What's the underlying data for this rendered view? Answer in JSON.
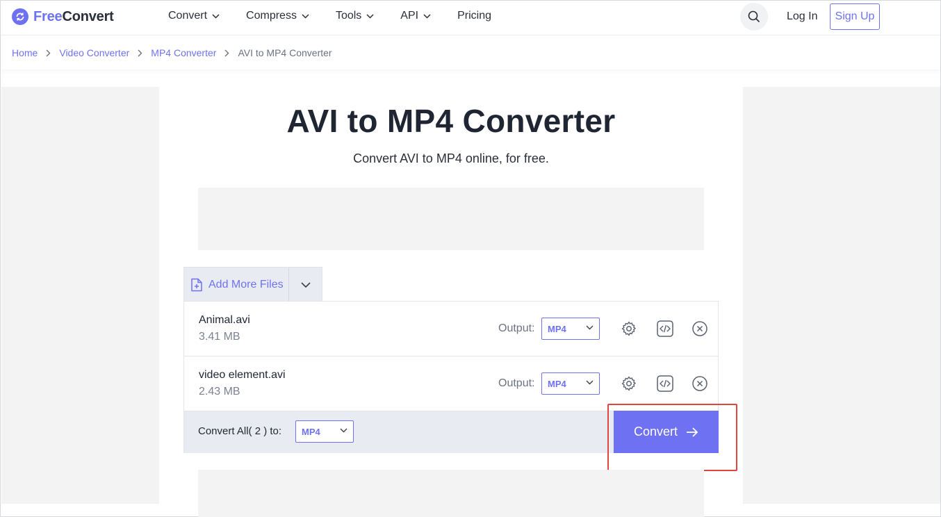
{
  "header": {
    "logo_free": "Free",
    "logo_convert": "Convert",
    "nav": [
      {
        "label": "Convert",
        "has_dropdown": true
      },
      {
        "label": "Compress",
        "has_dropdown": true
      },
      {
        "label": "Tools",
        "has_dropdown": true
      },
      {
        "label": "API",
        "has_dropdown": true
      },
      {
        "label": "Pricing",
        "has_dropdown": false
      }
    ],
    "search_icon": "search-icon",
    "login_label": "Log In",
    "signup_label": "Sign Up"
  },
  "breadcrumb": [
    {
      "label": "Home"
    },
    {
      "label": "Video Converter"
    },
    {
      "label": "MP4 Converter"
    },
    {
      "label": "AVI to MP4 Converter"
    }
  ],
  "main": {
    "title": "AVI to MP4 Converter",
    "subtitle": "Convert AVI to MP4 online, for free.",
    "add_files_label": "Add More Files",
    "files": [
      {
        "name": "Animal.avi",
        "size": "3.41 MB",
        "output_label": "Output:",
        "output_format": "MP4"
      },
      {
        "name": "video element.avi",
        "size": "2.43 MB",
        "output_label": "Output:",
        "output_format": "MP4"
      }
    ],
    "convert_all_label": "Convert All( 2 ) to:",
    "convert_all_format": "MP4",
    "convert_button_label": "Convert"
  },
  "colors": {
    "accent": "#6e72f2",
    "highlight": "#e0463c",
    "panel_bg": "#e9ebf2"
  }
}
